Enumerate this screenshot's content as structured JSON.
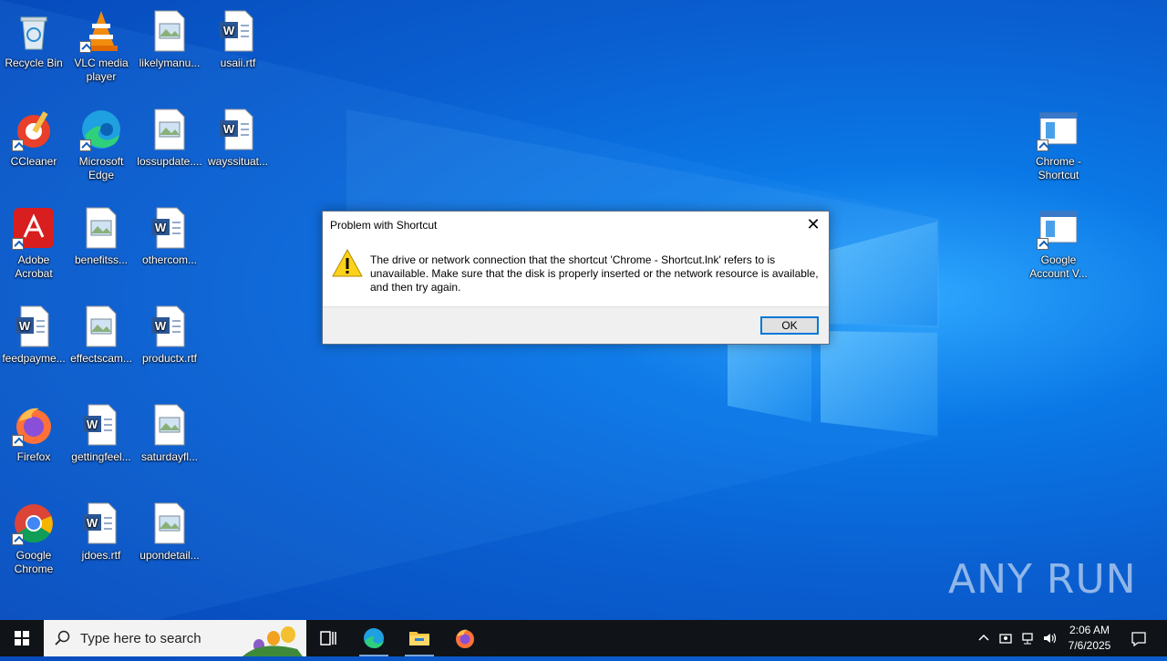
{
  "desktop": {
    "icons": [
      {
        "label": "Recycle Bin"
      },
      {
        "label": "VLC media player"
      },
      {
        "label": "likelymanu..."
      },
      {
        "label": "usaii.rtf"
      },
      {
        "label": "CCleaner"
      },
      {
        "label": "Microsoft Edge"
      },
      {
        "label": "lossupdate...."
      },
      {
        "label": "wayssituat..."
      },
      {
        "label": "Adobe Acrobat"
      },
      {
        "label": "benefitss..."
      },
      {
        "label": "othercom..."
      },
      {
        "label": "feedpayme..."
      },
      {
        "label": "effectscam..."
      },
      {
        "label": "productx.rtf"
      },
      {
        "label": "Firefox"
      },
      {
        "label": "gettingfeel..."
      },
      {
        "label": "saturdayfl..."
      },
      {
        "label": "Google Chrome"
      },
      {
        "label": "jdoes.rtf"
      },
      {
        "label": "upondetail..."
      },
      {
        "label": "Chrome - Shortcut"
      },
      {
        "label": "Google Account V..."
      }
    ]
  },
  "dialog": {
    "title": "Problem with Shortcut",
    "close": "✕",
    "message": "The drive or network connection that the shortcut 'Chrome - Shortcut.lnk' refers to is unavailable. Make sure that the disk is properly inserted or the network resource is available, and then try again.",
    "ok_label": "OK"
  },
  "taskbar": {
    "search_placeholder": "Type here to search",
    "time": "2:06 AM",
    "date": "7/6/2025"
  },
  "watermark": "ANY RUN"
}
